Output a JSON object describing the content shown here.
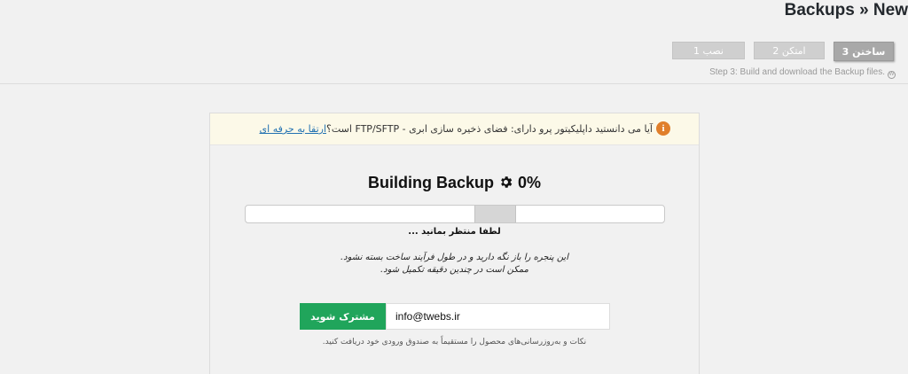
{
  "header": {
    "title": "Backups » New"
  },
  "steps": [
    {
      "label": "3 ساختن",
      "state": "active"
    },
    {
      "label": "2 امتکن",
      "state": "inactive"
    },
    {
      "label": "1 نصب",
      "state": "inactive"
    }
  ],
  "step_hint": "Step 3: Build and download the Backup files.",
  "notice": {
    "text": "آیا می دانستید داپلیکیتور پرو دارای: فضای ذخیره سازی ابری - FTP/SFTP است؟",
    "link": "ارتقا به حرفه ای"
  },
  "progress": {
    "title": "Building Backup",
    "percent_label": "0%",
    "percent": 0
  },
  "wait_text": "لطفا منتظر بمانید ...",
  "keep_open": {
    "line1": "این پنجره را باز نگه دارید و در طول فرآیند ساخت بسته نشود.",
    "line2": "ممکن است در چندین دقیقه تکمیل شود."
  },
  "subscribe": {
    "email_value": "info@twebs.ir",
    "button_label": "مشترک شوید"
  },
  "tips_text": "نکات و به‌روزرسانی‌های محصول را مستقیماً به صندوق ورودی خود دریافت کنید.",
  "colors": {
    "accent_green": "#20a55b",
    "info_orange": "#e07f2b",
    "link_blue": "#2271b1"
  },
  "icons": [
    "wordpress-icon",
    "info-icon",
    "gear-icon"
  ]
}
